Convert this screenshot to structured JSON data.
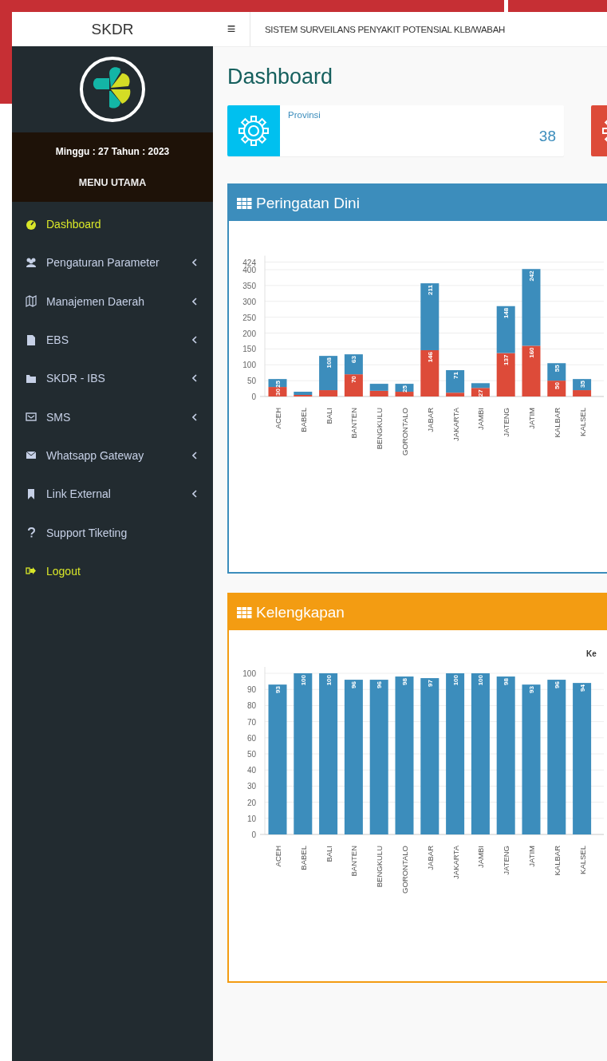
{
  "brand": "SKDR",
  "header": {
    "menu_toggle": "≡",
    "title": "SISTEM SURVEILANS PENYAKIT POTENSIAL KLB/WABAH"
  },
  "week_info": "Minggu : 27 Tahun : 2023",
  "menu_heading": "MENU UTAMA",
  "menu": [
    {
      "label": "Dashboard",
      "selected": true,
      "has_submenu": false
    },
    {
      "label": "Pengaturan Parameter",
      "selected": false,
      "has_submenu": true
    },
    {
      "label": "Manajemen Daerah",
      "selected": false,
      "has_submenu": true
    },
    {
      "label": "EBS",
      "selected": false,
      "has_submenu": true
    },
    {
      "label": "SKDR - IBS",
      "selected": false,
      "has_submenu": true
    },
    {
      "label": "SMS",
      "selected": false,
      "has_submenu": true
    },
    {
      "label": "Whatsapp Gateway",
      "selected": false,
      "has_submenu": true
    },
    {
      "label": "Link External",
      "selected": false,
      "has_submenu": true
    },
    {
      "label": "Support Tiketing",
      "selected": false,
      "has_submenu": false
    },
    {
      "label": "Logout",
      "selected": true,
      "has_submenu": false
    }
  ],
  "page_title": "Dashboard",
  "info_boxes": [
    {
      "label": "Provinsi",
      "value": "38",
      "color": "#00c0ef"
    },
    {
      "color": "#dd4b39"
    }
  ],
  "panels": [
    {
      "title": "Peringatan Dini",
      "color": "#3c8dbc",
      "chart_data": {
        "type": "bar",
        "stacked": true,
        "grid": true,
        "categories": [
          "ACEH",
          "BABEL",
          "BALI",
          "BANTEN",
          "BENGKULU",
          "GORONTALO",
          "JABAR",
          "JAKARTA",
          "JAMBI",
          "JATENG",
          "JATIM",
          "KALBAR",
          "KALSEL"
        ],
        "series": [
          {
            "color": "#dd4b39",
            "values": [
              30,
              5,
              20,
              70,
              18,
              15,
              146,
              12,
              27,
              137,
              160,
              50,
              20
            ],
            "value_labels": [
              "30",
              null,
              null,
              "70",
              null,
              null,
              "146",
              null,
              "27",
              "137",
              "160",
              "50",
              null
            ]
          },
          {
            "color": "#3c8dbc",
            "values": [
              25,
              10,
              108,
              63,
              22,
              25,
              211,
              71,
              15,
              148,
              242,
              55,
              35
            ],
            "value_labels": [
              "25",
              null,
              "108",
              "63",
              null,
              "25",
              "211",
              "71",
              null,
              "148",
              "242",
              "55",
              "35"
            ]
          }
        ],
        "ylim": [
          0,
          424
        ],
        "yticks": [
          0,
          50,
          100,
          150,
          200,
          250,
          300,
          350,
          400,
          424
        ]
      }
    },
    {
      "title": "Kelengkapan",
      "color": "#f39c12",
      "chart_data": {
        "type": "bar",
        "grid": true,
        "categories": [
          "ACEH",
          "BABEL",
          "BALI",
          "BANTEN",
          "BENGKULU",
          "GORONTALO",
          "JABAR",
          "JAKARTA",
          "JAMBI",
          "JATENG",
          "JATIM",
          "KALBAR",
          "KALSEL"
        ],
        "series": [
          {
            "name": "Ke",
            "color": "#3c8dbc",
            "values": [
              93,
              100,
              100,
              96,
              96,
              98,
              97,
              100,
              100,
              98,
              93,
              96,
              94
            ],
            "value_labels": [
              "93",
              "100",
              "100",
              "96",
              "96",
              "98",
              "97",
              "100",
              "100",
              "98",
              "93",
              "96",
              "94"
            ]
          }
        ],
        "ylim": [
          0,
          100
        ],
        "yticks": [
          0,
          10,
          20,
          30,
          40,
          50,
          60,
          70,
          80,
          90,
          100
        ]
      }
    }
  ]
}
